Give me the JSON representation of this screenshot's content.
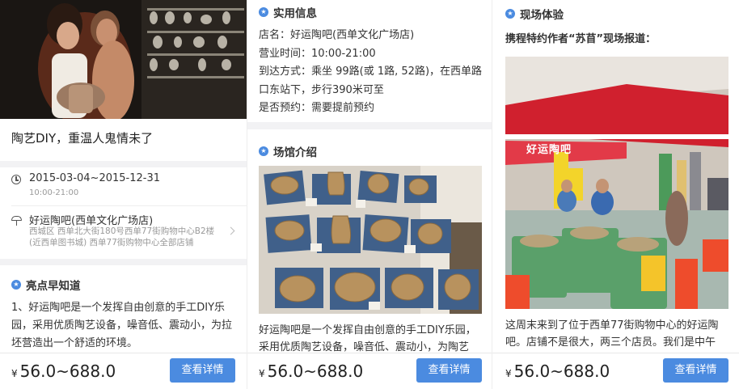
{
  "panel1": {
    "title": "陶艺DIY，重温人鬼情未了",
    "date_range": "2015-03-04~2015-12-31",
    "hours": "10:00-21:00",
    "venue_name": "好运陶吧(西单文化广场店)",
    "venue_address": "西城区 西单北大街180号西单77街购物中心B2楼(近西单图书城) 西单77街购物中心全部店铺",
    "highlights_title": "亮点早知道",
    "highlights_text": "1、好运陶吧是一个发挥自由创意的手工DIY乐园，采用优质陶艺设备，噪音低、震动小，为拉坯营造出一个舒适的环境。",
    "price_symbol": "¥",
    "price": "56.0~688.0",
    "button_label": "查看详情"
  },
  "panel2": {
    "info_title": "实用信息",
    "info_lines": [
      "店名：好运陶吧(西单文化广场店)",
      "营业时间：10:00-21:00",
      "到达方式：乘坐 99路(或 1路, 52路)，在西单路口东站下，步行390米可至",
      "是否预约：需要提前预约"
    ],
    "venue_title": "场馆介绍",
    "venue_text": "好运陶吧是一个发挥自由创意的手工DIY乐园，采用优质陶艺设备，噪音低、震动小，为陶艺",
    "price_symbol": "¥",
    "price": "56.0~688.0",
    "button_label": "查看详情"
  },
  "panel3": {
    "experience_title": "现场体验",
    "report_intro": "携程特约作者“苏苜”现场报道：",
    "shop_sign": "好运陶吧",
    "report_text": "这周末来到了位于西单77街购物中心的好运陶吧。店铺不是很大，两三个店员。我们是中午",
    "price_symbol": "¥",
    "price": "56.0~688.0",
    "button_label": "查看详情"
  },
  "colors": {
    "accent": "#4b8be0",
    "shop_red": "#d0202e"
  }
}
